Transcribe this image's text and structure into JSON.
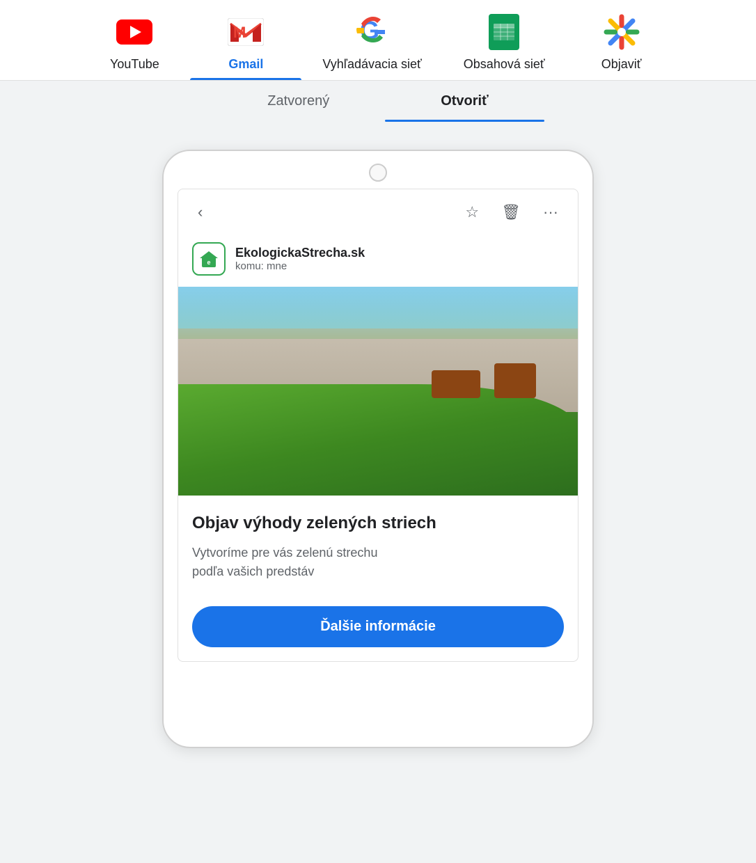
{
  "nav": {
    "items": [
      {
        "id": "youtube",
        "label": "YouTube",
        "icon": "youtube-icon"
      },
      {
        "id": "gmail",
        "label": "Gmail",
        "icon": "gmail-icon",
        "active": true
      },
      {
        "id": "vyhladavacia",
        "label": "Vyhľadávacia sieť",
        "icon": "google-icon"
      },
      {
        "id": "obsahova",
        "label": "Obsahová sieť",
        "icon": "sheets-icon"
      },
      {
        "id": "objavit",
        "label": "Objaviť",
        "icon": "discover-icon"
      }
    ]
  },
  "subtabs": {
    "items": [
      {
        "id": "zatvoreny",
        "label": "Zatvorený"
      },
      {
        "id": "otvoriť",
        "label": "Otvoriť",
        "active": true
      }
    ]
  },
  "email": {
    "back_label": "‹",
    "sender_name": "EkologickaStrecha.sk",
    "sender_to": "komu: mne",
    "headline": "Objav výhody zelených striech",
    "body": "Vytvoríme pre vás zelenú strechu\npodľa vašich predstáv",
    "cta": "Ďalšie informácie"
  },
  "toolbar": {
    "star_icon": "☆",
    "delete_icon": "🗑",
    "more_icon": "···"
  }
}
